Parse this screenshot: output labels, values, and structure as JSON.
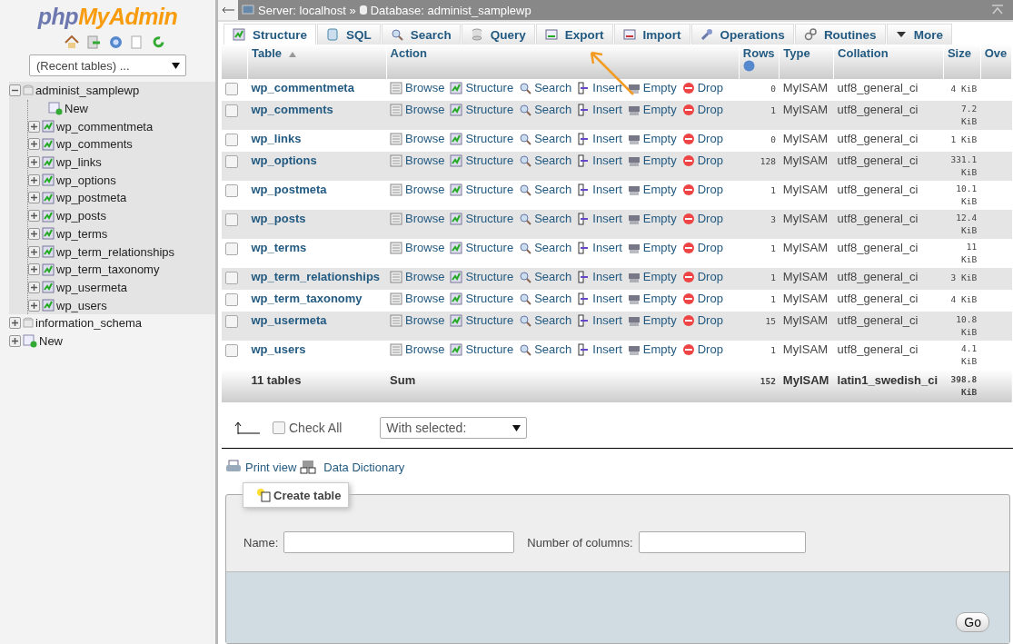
{
  "sidebar": {
    "logo": {
      "prefix": "php",
      "suffix": "MyAdmin"
    },
    "recent_tables": "(Recent tables) ...",
    "tree": [
      {
        "kind": "db",
        "label": "administ_samplewp",
        "expanded": true,
        "children": [
          {
            "kind": "new",
            "label": "New"
          },
          {
            "kind": "table",
            "label": "wp_commentmeta",
            "expanded": false
          },
          {
            "kind": "table",
            "label": "wp_comments",
            "expanded": false
          },
          {
            "kind": "table",
            "label": "wp_links",
            "expanded": false
          },
          {
            "kind": "table",
            "label": "wp_options",
            "expanded": false
          },
          {
            "kind": "table",
            "label": "wp_postmeta",
            "expanded": false
          },
          {
            "kind": "table",
            "label": "wp_posts",
            "expanded": false
          },
          {
            "kind": "table",
            "label": "wp_terms",
            "expanded": false
          },
          {
            "kind": "table",
            "label": "wp_term_relationships",
            "expanded": false
          },
          {
            "kind": "table",
            "label": "wp_term_taxonomy",
            "expanded": false
          },
          {
            "kind": "table",
            "label": "wp_usermeta",
            "expanded": false
          },
          {
            "kind": "table",
            "label": "wp_users",
            "expanded": false
          }
        ]
      },
      {
        "kind": "db",
        "label": "information_schema",
        "expanded": false
      },
      {
        "kind": "newdb",
        "label": "New",
        "expanded": false
      }
    ]
  },
  "breadcrumb": {
    "server": "Server: localhost »",
    "database": "Database: administ_samplewp"
  },
  "tabs": [
    {
      "kind": "structure",
      "label": "Structure",
      "selected": true
    },
    {
      "kind": "sql",
      "label": "SQL",
      "selected": false
    },
    {
      "kind": "search",
      "label": "Search",
      "selected": false
    },
    {
      "kind": "query",
      "label": "Query",
      "selected": false
    },
    {
      "kind": "export",
      "label": "Export",
      "selected": false
    },
    {
      "kind": "import",
      "label": "Import",
      "selected": false
    },
    {
      "kind": "operations",
      "label": "Operations",
      "selected": false
    },
    {
      "kind": "routines",
      "label": "Routines",
      "selected": false
    },
    {
      "kind": "more",
      "label": "More",
      "selected": false
    }
  ],
  "table": {
    "columns": [
      "Table",
      "Action",
      "Rows",
      "Type",
      "Collation",
      "Size",
      "Ove"
    ],
    "rows": [
      {
        "name": "wp_commentmeta",
        "checked": false,
        "actions": [
          "Browse",
          "Structure",
          "Search",
          "Insert",
          "Empty",
          "Drop"
        ],
        "rows": "0",
        "type": "MyISAM",
        "collation": "utf8_general_ci",
        "size": "4 KiB"
      },
      {
        "name": "wp_comments",
        "checked": false,
        "actions": [
          "Browse",
          "Structure",
          "Search",
          "Insert",
          "Empty",
          "Drop"
        ],
        "rows": "1",
        "type": "MyISAM",
        "collation": "utf8_general_ci",
        "size": "7.2 KiB"
      },
      {
        "name": "wp_links",
        "checked": false,
        "actions": [
          "Browse",
          "Structure",
          "Search",
          "Insert",
          "Empty",
          "Drop"
        ],
        "rows": "0",
        "type": "MyISAM",
        "collation": "utf8_general_ci",
        "size": "1 KiB"
      },
      {
        "name": "wp_options",
        "checked": false,
        "actions": [
          "Browse",
          "Structure",
          "Search",
          "Insert",
          "Empty",
          "Drop"
        ],
        "rows": "128",
        "type": "MyISAM",
        "collation": "utf8_general_ci",
        "size": "331.1 KiB"
      },
      {
        "name": "wp_postmeta",
        "checked": false,
        "actions": [
          "Browse",
          "Structure",
          "Search",
          "Insert",
          "Empty",
          "Drop"
        ],
        "rows": "1",
        "type": "MyISAM",
        "collation": "utf8_general_ci",
        "size": "10.1 KiB"
      },
      {
        "name": "wp_posts",
        "checked": false,
        "actions": [
          "Browse",
          "Structure",
          "Search",
          "Insert",
          "Empty",
          "Drop"
        ],
        "rows": "3",
        "type": "MyISAM",
        "collation": "utf8_general_ci",
        "size": "12.4 KiB"
      },
      {
        "name": "wp_terms",
        "checked": false,
        "actions": [
          "Browse",
          "Structure",
          "Search",
          "Insert",
          "Empty",
          "Drop"
        ],
        "rows": "1",
        "type": "MyISAM",
        "collation": "utf8_general_ci",
        "size": "11 KiB"
      },
      {
        "name": "wp_term_relationships",
        "checked": false,
        "actions": [
          "Browse",
          "Structure",
          "Search",
          "Insert",
          "Empty",
          "Drop"
        ],
        "rows": "1",
        "type": "MyISAM",
        "collation": "utf8_general_ci",
        "size": "3 KiB"
      },
      {
        "name": "wp_term_taxonomy",
        "checked": false,
        "actions": [
          "Browse",
          "Structure",
          "Search",
          "Insert",
          "Empty",
          "Drop"
        ],
        "rows": "1",
        "type": "MyISAM",
        "collation": "utf8_general_ci",
        "size": "4 KiB"
      },
      {
        "name": "wp_usermeta",
        "checked": false,
        "actions": [
          "Browse",
          "Structure",
          "Search",
          "Insert",
          "Empty",
          "Drop"
        ],
        "rows": "15",
        "type": "MyISAM",
        "collation": "utf8_general_ci",
        "size": "10.8 KiB"
      },
      {
        "name": "wp_users",
        "checked": false,
        "actions": [
          "Browse",
          "Structure",
          "Search",
          "Insert",
          "Empty",
          "Drop"
        ],
        "rows": "1",
        "type": "MyISAM",
        "collation": "utf8_general_ci",
        "size": "4.1 KiB"
      }
    ],
    "summary": {
      "name": "11 tables",
      "action": "Sum",
      "rows": "152",
      "type": "MyISAM",
      "collation": "latin1_swedish_ci",
      "size": "398.8 KiB"
    }
  },
  "bulk": {
    "check_all": "Check All",
    "checked": false,
    "with_selected": "With selected:"
  },
  "links": [
    "Print view",
    "Data Dictionary"
  ],
  "create_table": {
    "legend": "Create table",
    "name_label": "Name:",
    "columns_label": "Number of columns:",
    "go": "Go"
  }
}
